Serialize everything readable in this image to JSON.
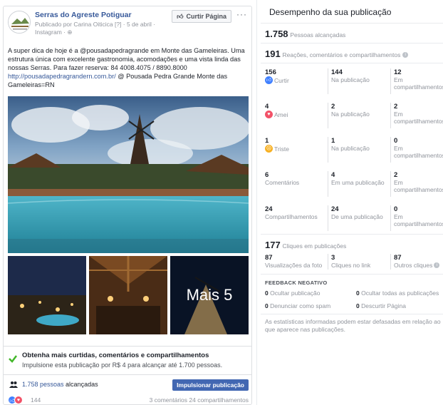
{
  "post": {
    "page_name": "Serras do Agreste Potiguar",
    "meta_line1": "Publicado por Carina Oiticica [?] · 5 de abril ·",
    "meta_line2": "Instagram · ",
    "like_page_label": "Curtir Página",
    "more_label": "···",
    "text_main": "A super dica de hoje é a @pousadapedragrande em Monte das Gameleiras. Uma estrutura única com excelente gastronomia, acomodações e uma vista linda das nossas Serras. Para fazer reserva: 84 4008.4075 / 8890.8000 ",
    "text_link": "http://pousadapedragrandern.com.br/",
    "text_tail": " @ Pousada Pedra Grande Monte das Gameleiras=RN",
    "more_photos_label": "Mais 5",
    "boost_title": "Obtenha mais curtidas, comentários e compartilhamentos",
    "boost_sub": "Impulsione esta publicação por R$ 4 para alcançar até 1.700 pessoas.",
    "reach_link": "1.758 pessoas",
    "reach_suffix": " alcançadas",
    "boost_button": "Impulsionar publicação",
    "reactions_count": "144",
    "footer_right": "3 comentários  24 compartilhamentos"
  },
  "panel": {
    "title": "Desempenho da sua publicação",
    "reach_num": "1.758",
    "reach_label": "Pessoas alcançadas",
    "engage_num": "191",
    "engage_label": "Reações, comentários e compartilhamentos",
    "rows": [
      {
        "n1": "156",
        "l1": "Curtir",
        "icon": "like-icon",
        "n2": "144",
        "l2": "Na publicação",
        "n3": "12",
        "l3": "Em compartilhamentos"
      },
      {
        "n1": "4",
        "l1": "Amei",
        "icon": "love-icon",
        "n2": "2",
        "l2": "Na publicação",
        "n3": "2",
        "l3": "Em compartilhamentos"
      },
      {
        "n1": "1",
        "l1": "Triste",
        "icon": "sad-icon",
        "n2": "1",
        "l2": "Na publicação",
        "n3": "0",
        "l3": "Em compartilhamentos"
      },
      {
        "n1": "6",
        "l1": "Comentários",
        "icon": "",
        "n2": "4",
        "l2": "Em uma publicação",
        "n3": "2",
        "l3": "Em compartilhamentos"
      },
      {
        "n1": "24",
        "l1": "Compartilhamentos",
        "icon": "",
        "n2": "24",
        "l2": "De uma publicação",
        "n3": "0",
        "l3": "Em compartilhamentos"
      }
    ],
    "clicks_num": "177",
    "clicks_label": "Cliques em publicações",
    "clicks": [
      {
        "n": "87",
        "l": "Visualizações da foto"
      },
      {
        "n": "3",
        "l": "Cliques no link"
      },
      {
        "n": "87",
        "l": "Outros cliques"
      }
    ],
    "feedback_title": "FEEDBACK NEGATIVO",
    "feedback": [
      {
        "n": "0",
        "l": "Ocultar publicação"
      },
      {
        "n": "0",
        "l": "Ocultar todas as publicações"
      },
      {
        "n": "0",
        "l": "Denunciar como spam"
      },
      {
        "n": "0",
        "l": "Descurtir Página"
      }
    ],
    "disclaimer": "As estatísticas informadas podem estar defasadas em relação ao que aparece nas publicações."
  },
  "colors": {
    "fb_blue": "#4267b2",
    "link": "#365899",
    "like": "#4080ff",
    "love": "#f25268",
    "sad": "#f7b125",
    "check": "#42b72a"
  }
}
